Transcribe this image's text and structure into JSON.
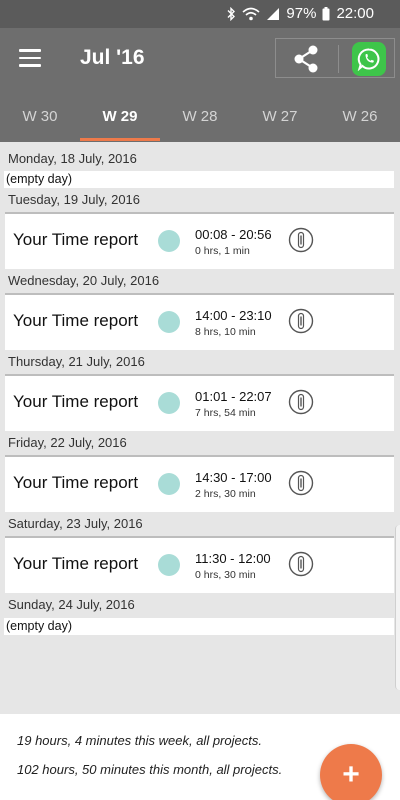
{
  "status_bar": {
    "battery": "97%",
    "time": "22:00",
    "icons": [
      "bluetooth-icon",
      "wifi-icon",
      "signal-icon",
      "battery-icon"
    ]
  },
  "app_bar": {
    "title": "Jul '16",
    "actions": [
      "menu-icon",
      "share-icon",
      "whatsapp-icon"
    ]
  },
  "tabs": [
    {
      "label": "W 30",
      "active": false
    },
    {
      "label": "W 29",
      "active": true
    },
    {
      "label": "W 28",
      "active": false
    },
    {
      "label": "W 27",
      "active": false
    },
    {
      "label": "W 26",
      "active": false
    }
  ],
  "days": [
    {
      "date": "Monday, 18 July, 2016",
      "empty_label": "(empty day)"
    },
    {
      "date": "Tuesday, 19 July, 2016",
      "entry": {
        "title": "Your Time report",
        "range": "00:08 - 20:56",
        "duration": "0 hrs, 1 min"
      }
    },
    {
      "date": "Wednesday, 20 July, 2016",
      "entry": {
        "title": "Your Time report",
        "range": "14:00 - 23:10",
        "duration": "8 hrs, 10 min"
      }
    },
    {
      "date": "Thursday, 21 July, 2016",
      "entry": {
        "title": "Your Time report",
        "range": "01:01 - 22:07",
        "duration": "7 hrs, 54 min"
      }
    },
    {
      "date": "Friday, 22 July, 2016",
      "entry": {
        "title": "Your Time report",
        "range": "14:30 - 17:00",
        "duration": "2 hrs, 30 min"
      }
    },
    {
      "date": "Saturday, 23 July, 2016",
      "entry": {
        "title": "Your Time report",
        "range": "11:30 - 12:00",
        "duration": "0 hrs, 30 min"
      }
    },
    {
      "date": "Sunday, 24 July, 2016",
      "empty_label": "(empty day)"
    }
  ],
  "footer": {
    "week_summary": "19 hours, 4 minutes this week, all projects.",
    "month_summary": "102 hours, 50 minutes this month, all projects."
  },
  "fab": {
    "label": "+"
  },
  "colors": {
    "app_bar": "#6e6e6e",
    "accent": "#ee7a4a",
    "dot": "#a9dcd7",
    "whatsapp": "#3ec54a"
  }
}
